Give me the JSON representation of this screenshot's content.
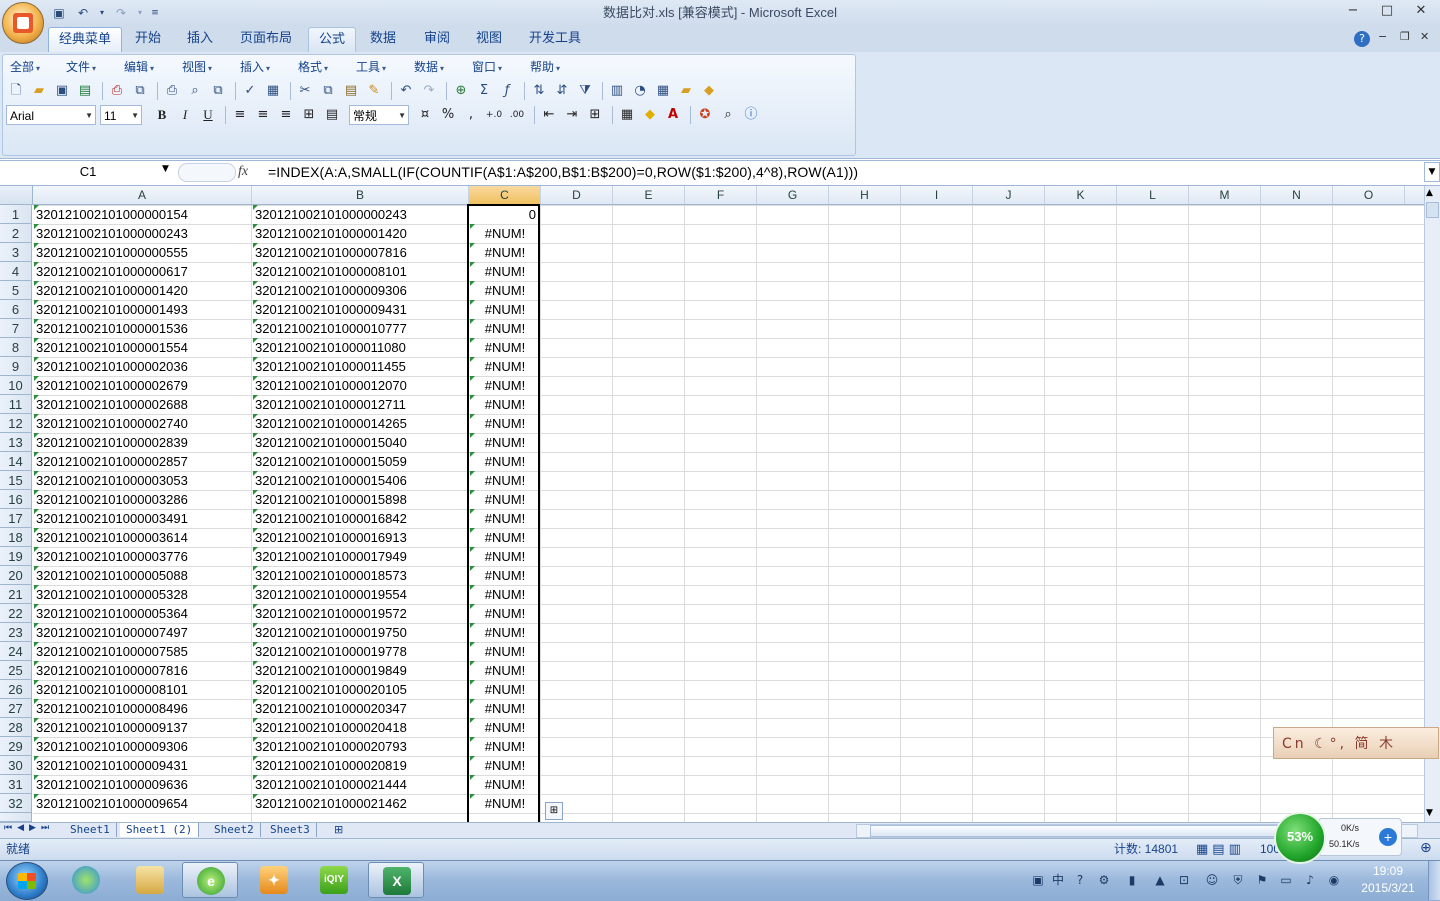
{
  "window": {
    "title": "数据比对.xls  [兼容模式] - Microsoft Excel",
    "controls": [
      "−",
      "□",
      "✕"
    ]
  },
  "ribbon_tabs": [
    {
      "label": "经典菜单",
      "state": "active"
    },
    {
      "label": "开始",
      "state": ""
    },
    {
      "label": "插入",
      "state": ""
    },
    {
      "label": "页面布局",
      "state": ""
    },
    {
      "label": "公式",
      "state": "hl"
    },
    {
      "label": "数据",
      "state": ""
    },
    {
      "label": "审阅",
      "state": ""
    },
    {
      "label": "视图",
      "state": ""
    },
    {
      "label": "开发工具",
      "state": ""
    }
  ],
  "menu": [
    "全部",
    "文件",
    "编辑",
    "视图",
    "插入",
    "格式",
    "工具",
    "数据",
    "窗口",
    "帮助"
  ],
  "format_bar": {
    "font": "Arial",
    "size": "11",
    "number_format": "常规",
    "bold": "B",
    "italic": "I",
    "underline": "U",
    "percent": "%",
    "comma": ","
  },
  "formula_bar": {
    "name_box": "C1",
    "fx": "fx",
    "formula": "=INDEX(A:A,SMALL(IF(COUNTIF(A$1:A$200,B$1:B$200)=0,ROW($1:$200),4^8),ROW(A1)))"
  },
  "columns": [
    "A",
    "B",
    "C",
    "D",
    "E",
    "F",
    "G",
    "H",
    "I",
    "J",
    "K",
    "L",
    "M",
    "N",
    "O"
  ],
  "selected_column": "C",
  "rows": [
    {
      "n": "1",
      "a": "320121002101000000154",
      "b": "320121002101000000243",
      "c": "0"
    },
    {
      "n": "2",
      "a": "320121002101000000243",
      "b": "320121002101000001420",
      "c": "#NUM!"
    },
    {
      "n": "3",
      "a": "320121002101000000555",
      "b": "320121002101000007816",
      "c": "#NUM!"
    },
    {
      "n": "4",
      "a": "320121002101000000617",
      "b": "320121002101000008101",
      "c": "#NUM!"
    },
    {
      "n": "5",
      "a": "320121002101000001420",
      "b": "320121002101000009306",
      "c": "#NUM!"
    },
    {
      "n": "6",
      "a": "320121002101000001493",
      "b": "320121002101000009431",
      "c": "#NUM!"
    },
    {
      "n": "7",
      "a": "320121002101000001536",
      "b": "320121002101000010777",
      "c": "#NUM!"
    },
    {
      "n": "8",
      "a": "320121002101000001554",
      "b": "320121002101000011080",
      "c": "#NUM!"
    },
    {
      "n": "9",
      "a": "320121002101000002036",
      "b": "320121002101000011455",
      "c": "#NUM!"
    },
    {
      "n": "10",
      "a": "320121002101000002679",
      "b": "320121002101000012070",
      "c": "#NUM!"
    },
    {
      "n": "11",
      "a": "320121002101000002688",
      "b": "320121002101000012711",
      "c": "#NUM!"
    },
    {
      "n": "12",
      "a": "320121002101000002740",
      "b": "320121002101000014265",
      "c": "#NUM!"
    },
    {
      "n": "13",
      "a": "320121002101000002839",
      "b": "320121002101000015040",
      "c": "#NUM!"
    },
    {
      "n": "14",
      "a": "320121002101000002857",
      "b": "320121002101000015059",
      "c": "#NUM!"
    },
    {
      "n": "15",
      "a": "320121002101000003053",
      "b": "320121002101000015406",
      "c": "#NUM!"
    },
    {
      "n": "16",
      "a": "320121002101000003286",
      "b": "320121002101000015898",
      "c": "#NUM!"
    },
    {
      "n": "17",
      "a": "320121002101000003491",
      "b": "320121002101000016842",
      "c": "#NUM!"
    },
    {
      "n": "18",
      "a": "320121002101000003614",
      "b": "320121002101000016913",
      "c": "#NUM!"
    },
    {
      "n": "19",
      "a": "320121002101000003776",
      "b": "320121002101000017949",
      "c": "#NUM!"
    },
    {
      "n": "20",
      "a": "320121002101000005088",
      "b": "320121002101000018573",
      "c": "#NUM!"
    },
    {
      "n": "21",
      "a": "320121002101000005328",
      "b": "320121002101000019554",
      "c": "#NUM!"
    },
    {
      "n": "22",
      "a": "320121002101000005364",
      "b": "320121002101000019572",
      "c": "#NUM!"
    },
    {
      "n": "23",
      "a": "320121002101000007497",
      "b": "320121002101000019750",
      "c": "#NUM!"
    },
    {
      "n": "24",
      "a": "320121002101000007585",
      "b": "320121002101000019778",
      "c": "#NUM!"
    },
    {
      "n": "25",
      "a": "320121002101000007816",
      "b": "320121002101000019849",
      "c": "#NUM!"
    },
    {
      "n": "26",
      "a": "320121002101000008101",
      "b": "320121002101000020105",
      "c": "#NUM!"
    },
    {
      "n": "27",
      "a": "320121002101000008496",
      "b": "320121002101000020347",
      "c": "#NUM!"
    },
    {
      "n": "28",
      "a": "320121002101000009137",
      "b": "320121002101000020418",
      "c": "#NUM!"
    },
    {
      "n": "29",
      "a": "320121002101000009306",
      "b": "320121002101000020793",
      "c": "#NUM!"
    },
    {
      "n": "30",
      "a": "320121002101000009431",
      "b": "320121002101000020819",
      "c": "#NUM!"
    },
    {
      "n": "31",
      "a": "320121002101000009636",
      "b": "320121002101000021444",
      "c": "#NUM!"
    },
    {
      "n": "32",
      "a": "320121002101000009654",
      "b": "320121002101000021462",
      "c": "#NUM!"
    }
  ],
  "sheet_tabs": [
    {
      "label": "Sheet1",
      "active": false
    },
    {
      "label": "Sheet1 (2)",
      "active": true
    },
    {
      "label": "Sheet2",
      "active": false
    },
    {
      "label": "Sheet3",
      "active": false
    }
  ],
  "status": {
    "ready": "就绪",
    "count": "计数: 14801",
    "zoom": "100%"
  },
  "ime_bar": "Cn ☾°, 简 木",
  "net_monitor": {
    "percent": "53%",
    "up": "0K/s",
    "down": "50.1K/s"
  },
  "taskbar": {
    "time": "19:09",
    "date": "2015/3/21",
    "tray_ime": "中"
  },
  "colors": {
    "ribbon": "#dbe7f5",
    "selection_header": "#f1c15f",
    "text_indicator": "#2c8f3c",
    "excel_green": "#1d7a3a"
  }
}
